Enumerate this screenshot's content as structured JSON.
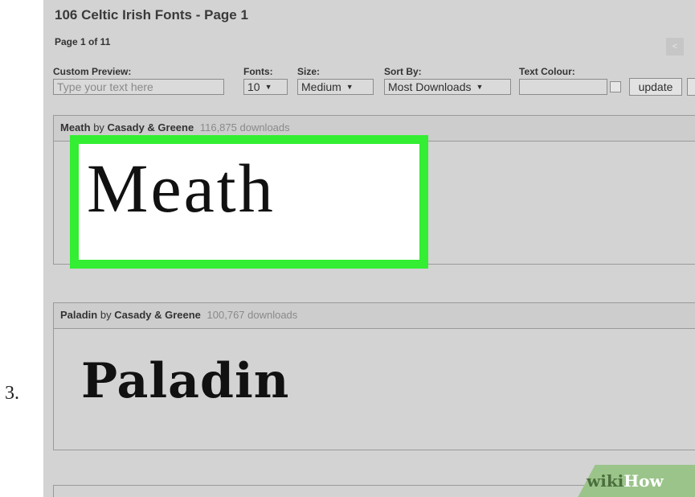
{
  "step": {
    "number": "3."
  },
  "page": {
    "title": "106 Celtic Irish Fonts - Page 1",
    "page_info": "Page 1 of 11",
    "prev_label": "<"
  },
  "controls": {
    "custom_preview_label": "Custom Preview:",
    "custom_preview_placeholder": "Type your text here",
    "fonts_label": "Fonts:",
    "fonts_value": "10",
    "size_label": "Size:",
    "size_value": "Medium",
    "sort_label": "Sort By:",
    "sort_value": "Most Downloads",
    "colour_label": "Text Colour:",
    "colour_value": "",
    "update_label": "update"
  },
  "fonts": [
    {
      "name": "Meath",
      "by": "by",
      "author": "Casady & Greene",
      "downloads": "116,875 downloads",
      "preview": "Meath"
    },
    {
      "name": "Paladin",
      "by": "by",
      "author": "Casady & Greene",
      "downloads": "100,767 downloads",
      "preview": "Paladin"
    }
  ],
  "highlight_color": "#33ee33",
  "watermark": {
    "wiki": "wiki",
    "how": "How"
  }
}
